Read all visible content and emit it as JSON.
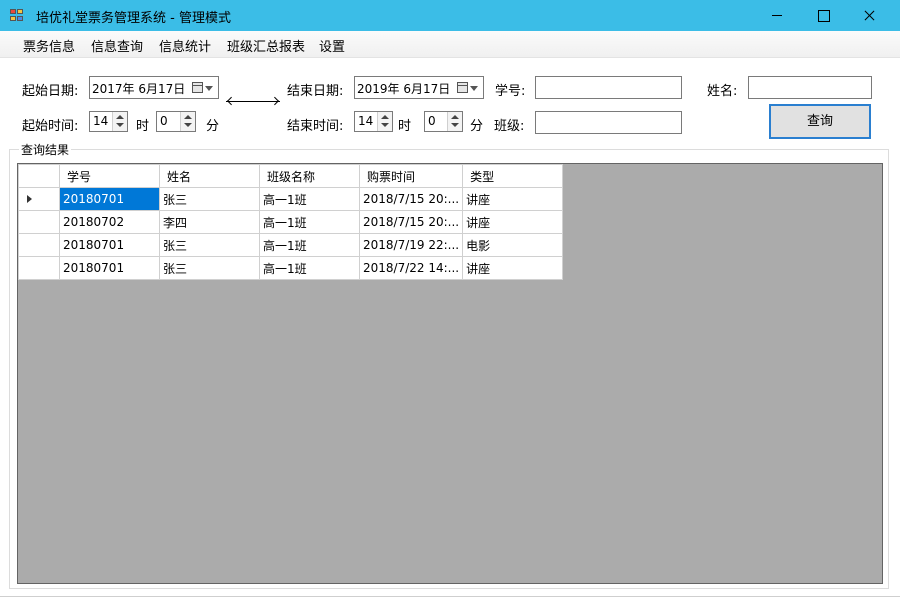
{
  "window": {
    "title": "培优礼堂票务管理系统 - 管理模式"
  },
  "menu": {
    "items": [
      "票务信息",
      "信息查询",
      "信息统计",
      "班级汇总报表",
      "设置"
    ]
  },
  "form": {
    "start_date_label": "起始日期:",
    "start_date_value": "2017年  6月17日",
    "end_date_label": "结束日期:",
    "end_date_value": "2019年  6月17日",
    "student_id_label": "学号:",
    "student_id_value": "",
    "name_label": "姓名:",
    "name_value": "",
    "start_time_label": "起始时间:",
    "start_hour": "14",
    "start_minute": "0",
    "hour_label": "时",
    "minute_label": "分",
    "end_time_label": "结束时间:",
    "end_hour": "14",
    "end_minute": "0",
    "class_label": "班级:",
    "class_value": "",
    "query_button": "查询"
  },
  "results": {
    "group_title": "查询结果",
    "columns": [
      "学号",
      "姓名",
      "班级名称",
      "购票时间",
      "类型"
    ],
    "rows": [
      [
        "20180701",
        "张三",
        "高一1班",
        "2018/7/15 20:...",
        "讲座"
      ],
      [
        "20180702",
        "李四",
        "高一1班",
        "2018/7/15 20:...",
        "讲座"
      ],
      [
        "20180701",
        "张三",
        "高一1班",
        "2018/7/19 22:...",
        "电影"
      ],
      [
        "20180701",
        "张三",
        "高一1班",
        "2018/7/22 14:...",
        "讲座"
      ]
    ],
    "selected_row": 0
  }
}
